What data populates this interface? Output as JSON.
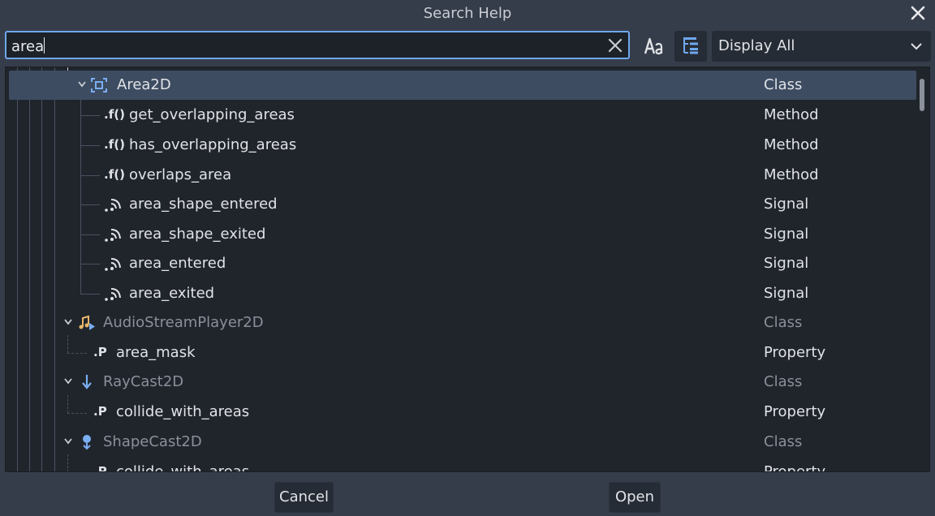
{
  "window": {
    "title": "Search Help"
  },
  "search": {
    "value": "area"
  },
  "filter": {
    "selected": "Display All"
  },
  "rows": [
    {
      "name": "Area2D",
      "type": "Class"
    },
    {
      "name": "get_overlapping_areas",
      "type": "Method"
    },
    {
      "name": "has_overlapping_areas",
      "type": "Method"
    },
    {
      "name": "overlaps_area",
      "type": "Method"
    },
    {
      "name": "area_shape_entered",
      "type": "Signal"
    },
    {
      "name": "area_shape_exited",
      "type": "Signal"
    },
    {
      "name": "area_entered",
      "type": "Signal"
    },
    {
      "name": "area_exited",
      "type": "Signal"
    },
    {
      "name": "AudioStreamPlayer2D",
      "type": "Class"
    },
    {
      "name": "area_mask",
      "type": "Property"
    },
    {
      "name": "RayCast2D",
      "type": "Class"
    },
    {
      "name": "collide_with_areas",
      "type": "Property"
    },
    {
      "name": "ShapeCast2D",
      "type": "Class"
    },
    {
      "name": "collide_with_areas",
      "type": "Property"
    }
  ],
  "icon_labels": {
    "method": ".f()",
    "property": ".P"
  },
  "buttons": {
    "cancel": "Cancel",
    "open": "Open"
  },
  "colors": {
    "accent": "#6fa8ef",
    "selection": "#3d4c61",
    "background": "#363d4a",
    "tree_background": "#20252c"
  }
}
